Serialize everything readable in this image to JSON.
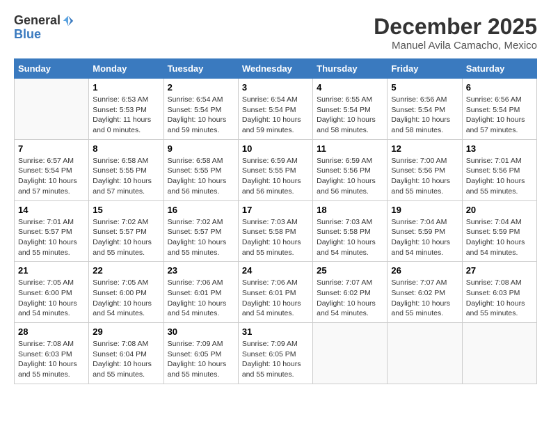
{
  "header": {
    "logo_line1": "General",
    "logo_line2": "Blue",
    "calendar_title": "December 2025",
    "calendar_subtitle": "Manuel Avila Camacho, Mexico"
  },
  "days_of_week": [
    "Sunday",
    "Monday",
    "Tuesday",
    "Wednesday",
    "Thursday",
    "Friday",
    "Saturday"
  ],
  "weeks": [
    [
      {
        "day": "",
        "info": ""
      },
      {
        "day": "1",
        "info": "Sunrise: 6:53 AM\nSunset: 5:53 PM\nDaylight: 11 hours\nand 0 minutes."
      },
      {
        "day": "2",
        "info": "Sunrise: 6:54 AM\nSunset: 5:54 PM\nDaylight: 10 hours\nand 59 minutes."
      },
      {
        "day": "3",
        "info": "Sunrise: 6:54 AM\nSunset: 5:54 PM\nDaylight: 10 hours\nand 59 minutes."
      },
      {
        "day": "4",
        "info": "Sunrise: 6:55 AM\nSunset: 5:54 PM\nDaylight: 10 hours\nand 58 minutes."
      },
      {
        "day": "5",
        "info": "Sunrise: 6:56 AM\nSunset: 5:54 PM\nDaylight: 10 hours\nand 58 minutes."
      },
      {
        "day": "6",
        "info": "Sunrise: 6:56 AM\nSunset: 5:54 PM\nDaylight: 10 hours\nand 57 minutes."
      }
    ],
    [
      {
        "day": "7",
        "info": "Sunrise: 6:57 AM\nSunset: 5:54 PM\nDaylight: 10 hours\nand 57 minutes."
      },
      {
        "day": "8",
        "info": "Sunrise: 6:58 AM\nSunset: 5:55 PM\nDaylight: 10 hours\nand 57 minutes."
      },
      {
        "day": "9",
        "info": "Sunrise: 6:58 AM\nSunset: 5:55 PM\nDaylight: 10 hours\nand 56 minutes."
      },
      {
        "day": "10",
        "info": "Sunrise: 6:59 AM\nSunset: 5:55 PM\nDaylight: 10 hours\nand 56 minutes."
      },
      {
        "day": "11",
        "info": "Sunrise: 6:59 AM\nSunset: 5:56 PM\nDaylight: 10 hours\nand 56 minutes."
      },
      {
        "day": "12",
        "info": "Sunrise: 7:00 AM\nSunset: 5:56 PM\nDaylight: 10 hours\nand 55 minutes."
      },
      {
        "day": "13",
        "info": "Sunrise: 7:01 AM\nSunset: 5:56 PM\nDaylight: 10 hours\nand 55 minutes."
      }
    ],
    [
      {
        "day": "14",
        "info": "Sunrise: 7:01 AM\nSunset: 5:57 PM\nDaylight: 10 hours\nand 55 minutes."
      },
      {
        "day": "15",
        "info": "Sunrise: 7:02 AM\nSunset: 5:57 PM\nDaylight: 10 hours\nand 55 minutes."
      },
      {
        "day": "16",
        "info": "Sunrise: 7:02 AM\nSunset: 5:57 PM\nDaylight: 10 hours\nand 55 minutes."
      },
      {
        "day": "17",
        "info": "Sunrise: 7:03 AM\nSunset: 5:58 PM\nDaylight: 10 hours\nand 55 minutes."
      },
      {
        "day": "18",
        "info": "Sunrise: 7:03 AM\nSunset: 5:58 PM\nDaylight: 10 hours\nand 54 minutes."
      },
      {
        "day": "19",
        "info": "Sunrise: 7:04 AM\nSunset: 5:59 PM\nDaylight: 10 hours\nand 54 minutes."
      },
      {
        "day": "20",
        "info": "Sunrise: 7:04 AM\nSunset: 5:59 PM\nDaylight: 10 hours\nand 54 minutes."
      }
    ],
    [
      {
        "day": "21",
        "info": "Sunrise: 7:05 AM\nSunset: 6:00 PM\nDaylight: 10 hours\nand 54 minutes."
      },
      {
        "day": "22",
        "info": "Sunrise: 7:05 AM\nSunset: 6:00 PM\nDaylight: 10 hours\nand 54 minutes."
      },
      {
        "day": "23",
        "info": "Sunrise: 7:06 AM\nSunset: 6:01 PM\nDaylight: 10 hours\nand 54 minutes."
      },
      {
        "day": "24",
        "info": "Sunrise: 7:06 AM\nSunset: 6:01 PM\nDaylight: 10 hours\nand 54 minutes."
      },
      {
        "day": "25",
        "info": "Sunrise: 7:07 AM\nSunset: 6:02 PM\nDaylight: 10 hours\nand 54 minutes."
      },
      {
        "day": "26",
        "info": "Sunrise: 7:07 AM\nSunset: 6:02 PM\nDaylight: 10 hours\nand 55 minutes."
      },
      {
        "day": "27",
        "info": "Sunrise: 7:08 AM\nSunset: 6:03 PM\nDaylight: 10 hours\nand 55 minutes."
      }
    ],
    [
      {
        "day": "28",
        "info": "Sunrise: 7:08 AM\nSunset: 6:03 PM\nDaylight: 10 hours\nand 55 minutes."
      },
      {
        "day": "29",
        "info": "Sunrise: 7:08 AM\nSunset: 6:04 PM\nDaylight: 10 hours\nand 55 minutes."
      },
      {
        "day": "30",
        "info": "Sunrise: 7:09 AM\nSunset: 6:05 PM\nDaylight: 10 hours\nand 55 minutes."
      },
      {
        "day": "31",
        "info": "Sunrise: 7:09 AM\nSunset: 6:05 PM\nDaylight: 10 hours\nand 55 minutes."
      },
      {
        "day": "",
        "info": ""
      },
      {
        "day": "",
        "info": ""
      },
      {
        "day": "",
        "info": ""
      }
    ]
  ]
}
